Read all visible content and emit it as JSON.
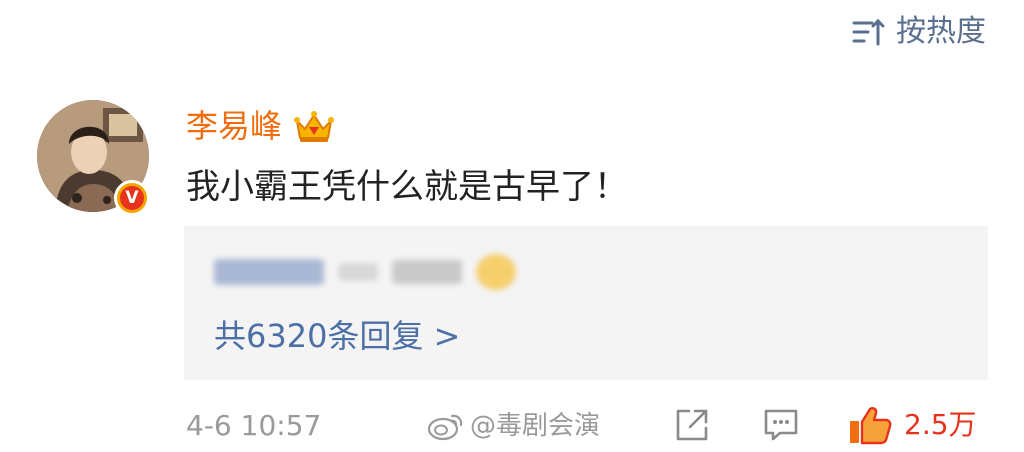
{
  "header": {
    "sort_label": "按热度",
    "sort_icon": "sort-lines-icon"
  },
  "comment": {
    "author": "李易峰",
    "author_color": "#f26d0f",
    "badge_icon": "crown-icon",
    "verified_mark": "V",
    "text": "我小霸王凭什么就是古早了！",
    "reply_summary": "共6320条回复 >",
    "timestamp": "4-6 10:57",
    "watermark": "@毒剧会演",
    "like_count": "2.5万",
    "like_color": "#e8331c"
  },
  "icons": {
    "share": "share-icon",
    "reply": "comment-icon",
    "like": "thumbs-up-icon"
  }
}
